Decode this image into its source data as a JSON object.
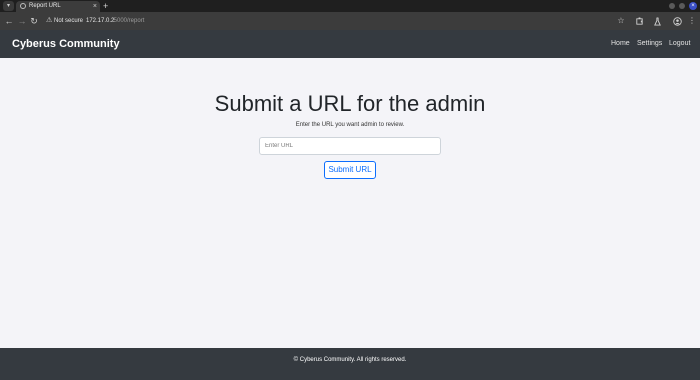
{
  "browser": {
    "tab_title": "Report URL",
    "tab_close": "×",
    "new_tab": "+",
    "tab_list": "▾",
    "security_warning": "Not secure",
    "url_host": "172.17.0.2",
    "url_rest": ":5000/report",
    "icons": {
      "back": "arrow-left-icon",
      "forward": "arrow-right-icon",
      "reload": "reload-icon",
      "warning": "warning-icon",
      "bookmark": "star-icon",
      "extensions": "puzzle-icon",
      "labs": "flask-icon",
      "profile": "profile-icon",
      "menu": "kebab-menu-icon"
    }
  },
  "navbar": {
    "brand": "Cyberus Community",
    "links": [
      "Home",
      "Settings",
      "Logout"
    ]
  },
  "main": {
    "title": "Submit a URL for the admin",
    "subtitle": "Enter the URL you want admin to review.",
    "url_input": {
      "placeholder": "Enter URL",
      "value": ""
    },
    "submit_label": "Submit URL"
  },
  "footer": {
    "text": "© Cyberus Community. All rights reserved."
  },
  "colors": {
    "navbar_bg": "#353a40",
    "page_bg": "#f4f4f8",
    "accent": "#0d6efd"
  }
}
